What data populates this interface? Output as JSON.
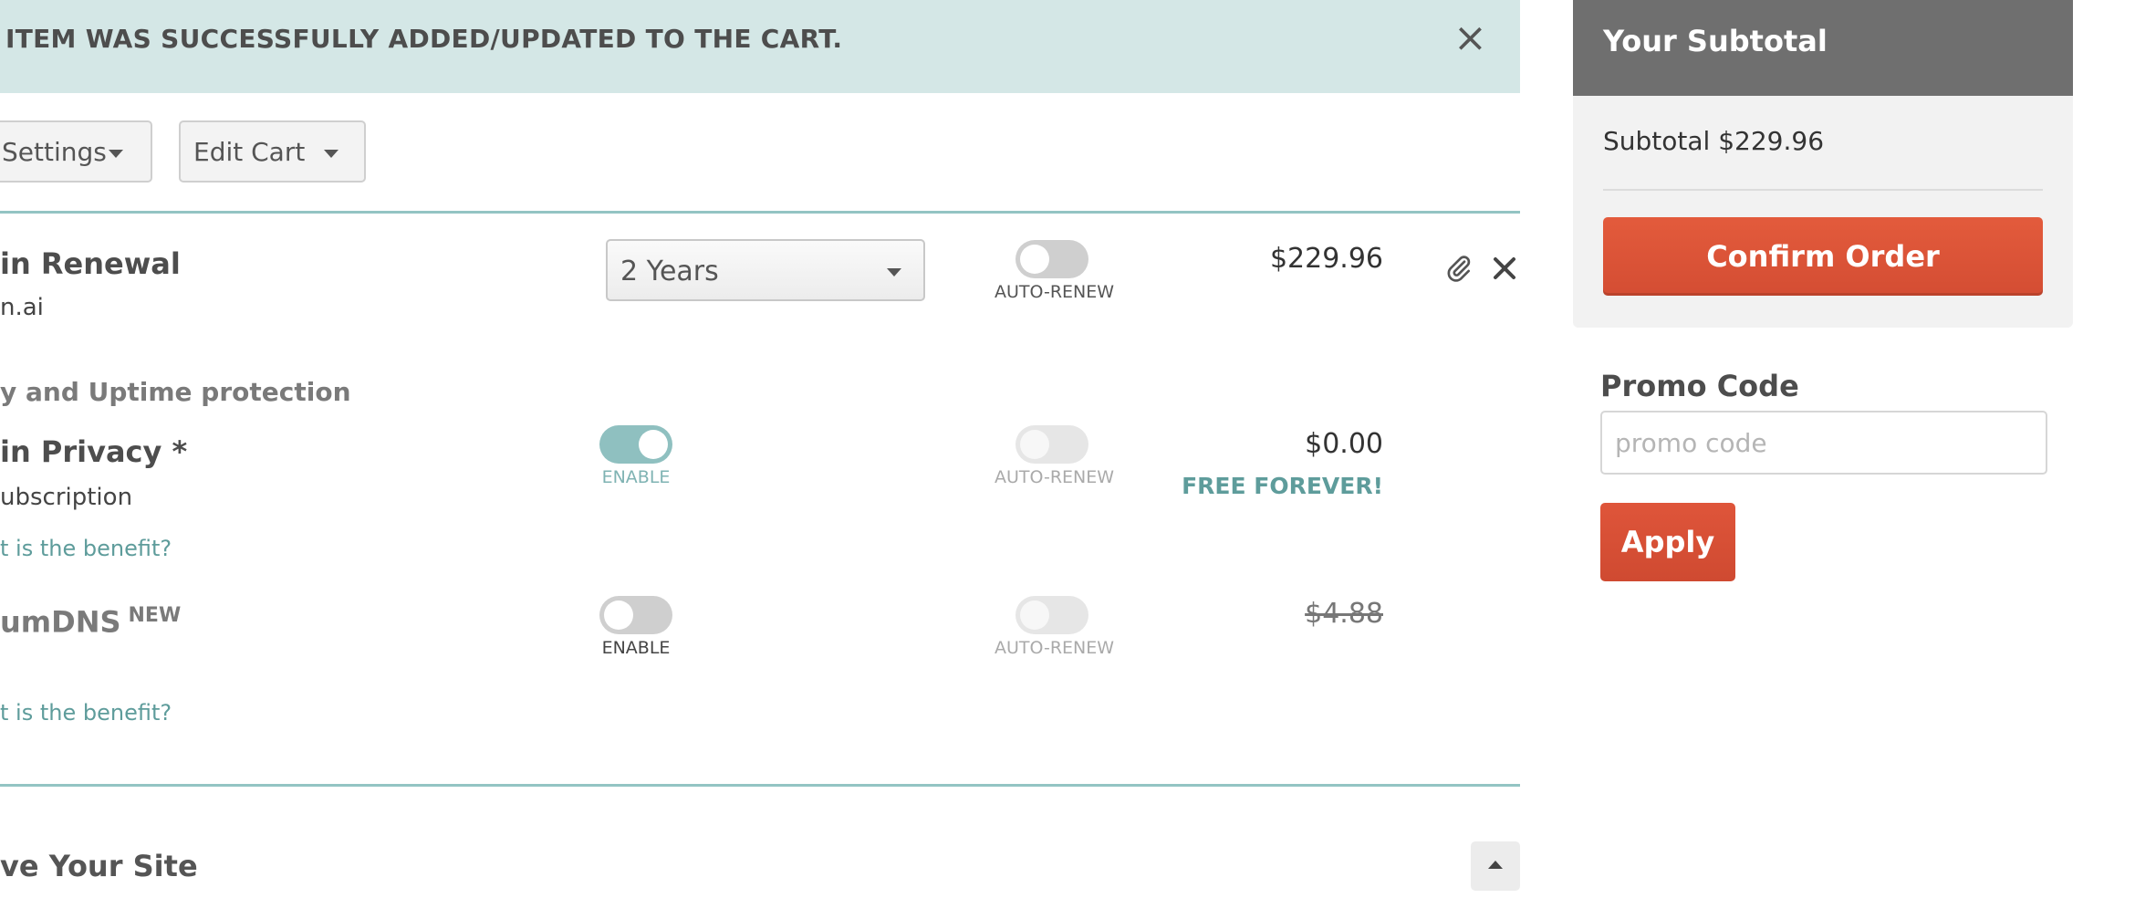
{
  "alert": {
    "message": "ITEM WAS SUCCESSFULLY ADDED/UPDATED TO THE CART.",
    "close_symbol": "×"
  },
  "toolbar": {
    "settings_label": "Settings",
    "edit_cart_label": "Edit Cart"
  },
  "items": [
    {
      "title": "in Renewal",
      "subtitle": "n.ai",
      "term": "2 Years",
      "autorenew_label": "AUTO-RENEW",
      "price": "$229.96"
    }
  ],
  "addons": {
    "section_label": "y and Uptime protection",
    "privacy": {
      "title": "in Privacy *",
      "subtitle": "ubscription",
      "link": "t is the benefit?",
      "enable_label": "ENABLE",
      "autorenew_label": "AUTO-RENEW",
      "price": "$0.00",
      "price_note": "FREE FOREVER!"
    },
    "dns": {
      "title": "umDNS",
      "badge": "NEW",
      "link": "t is the benefit?",
      "enable_label": "ENABLE",
      "autorenew_label": "AUTO-RENEW",
      "price": "$4.88"
    }
  },
  "next_section": {
    "title": "ve Your Site"
  },
  "sidebar": {
    "title": "Your Subtotal",
    "subtotal": "Subtotal $229.96",
    "confirm_label": "Confirm Order",
    "promo_title": "Promo Code",
    "promo_placeholder": "promo code",
    "apply_label": "Apply"
  },
  "colors": {
    "alert_bg": "#d4e7e6",
    "accent_teal": "#5e9c9b",
    "confirm_red": "#e0553a",
    "sidebar_header": "#6f6f6f"
  }
}
